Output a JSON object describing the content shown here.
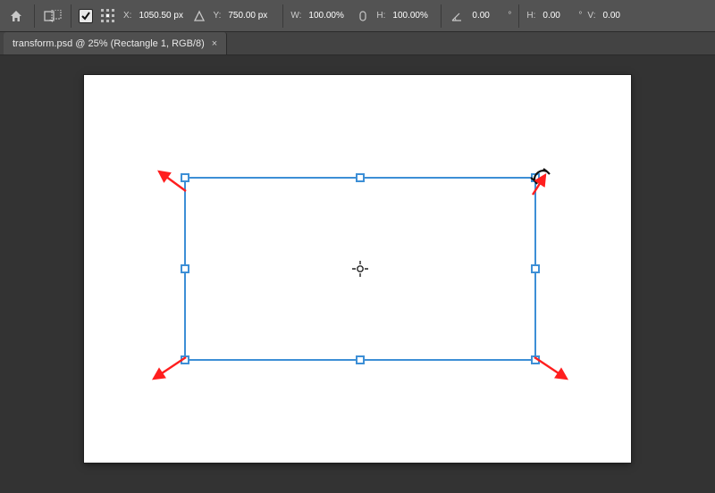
{
  "options": {
    "x_label": "X:",
    "x_value": "1050.50 px",
    "y_label": "Y:",
    "y_value": "750.00 px",
    "w_label": "W:",
    "w_value": "100.00%",
    "h_label": "H:",
    "h_value": "100.00%",
    "angle_value": "0.00",
    "skew_h_label": "H:",
    "skew_h_value": "0.00",
    "skew_v_label": "V:",
    "skew_v_value": "0.00",
    "deg": "°"
  },
  "tab": {
    "title": "transform.psd @ 25% (Rectangle 1, RGB/8)",
    "close": "×"
  },
  "icons": {
    "home": "home-icon",
    "cancel": "cancel-transform-icon",
    "commit": "commit-transform-icon",
    "toggle_ref": "toggle-reference-point-checkbox",
    "ref_point": "reference-point-icon",
    "triangle": "relative-positioning-icon",
    "link": "constrain-proportions-icon",
    "angle": "rotate-angle-icon",
    "skew_h": "skew-horizontal-icon",
    "skew_v": "skew-vertical-icon",
    "interp": "interpolation-icon"
  }
}
